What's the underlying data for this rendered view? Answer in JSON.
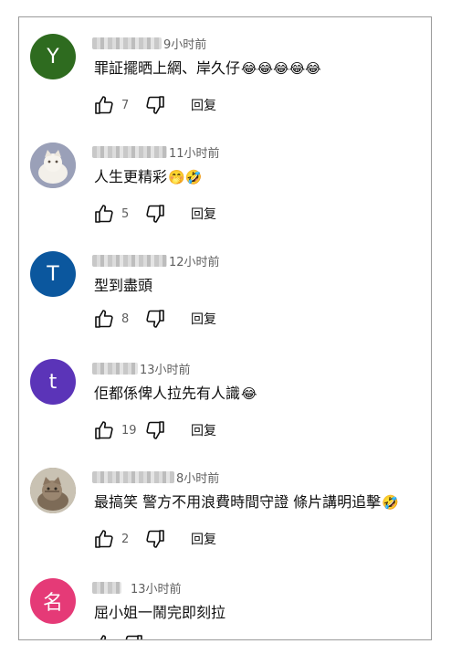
{
  "comments": [
    {
      "avatar_letter": "Y",
      "avatar_color": "#2e6b1f",
      "time": "9小时前",
      "text": "罪証擺晒上網、岸久仔",
      "emoji": "😂😂😂😂😂",
      "likes": "7",
      "reply": "回复"
    },
    {
      "avatar_letter": "",
      "avatar_color": "#b7b8c4",
      "time": "11小时前",
      "text": "人生更精彩",
      "emoji": "🤭🤣",
      "likes": "5",
      "reply": "回复"
    },
    {
      "avatar_letter": "T",
      "avatar_color": "#0b579e",
      "time": "12小时前",
      "text": "型到盡頭",
      "emoji": "",
      "likes": "8",
      "reply": "回复"
    },
    {
      "avatar_letter": "t",
      "avatar_color": "#5b34b8",
      "time": "13小时前",
      "text": "佢都係俾人拉先有人識",
      "emoji": "😂",
      "likes": "19",
      "reply": "回复"
    },
    {
      "avatar_letter": "",
      "avatar_color": "#8a7a68",
      "time": "8小时前",
      "text": "最搞笑 警方不用浪費時間守證 條片講明追擊",
      "emoji": "🤣",
      "likes": "2",
      "reply": "回复"
    },
    {
      "avatar_letter": "名",
      "avatar_color": "#e53a77",
      "time": "13小时前",
      "text": "屈小姐一鬧完即刻拉",
      "emoji": "",
      "likes": "",
      "reply": ""
    }
  ]
}
